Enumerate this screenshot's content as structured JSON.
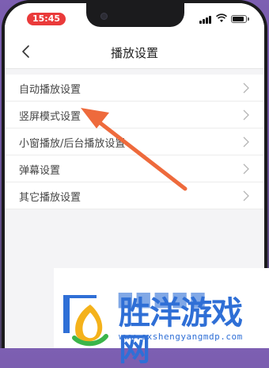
{
  "status_bar": {
    "time": "15:45",
    "icons": [
      "signal-icon",
      "wifi-icon",
      "battery-icon"
    ],
    "battery_level": 0.85
  },
  "navbar": {
    "back_icon": "chevron-left-icon",
    "title": "播放设置"
  },
  "settings": [
    {
      "label": "自动播放设置"
    },
    {
      "label": "竖屏模式设置"
    },
    {
      "label": "小窗播放/后台播放设置"
    },
    {
      "label": "弹幕设置"
    },
    {
      "label": "其它播放设置"
    }
  ],
  "annotation": {
    "type": "arrow",
    "color": "#ee6a3c"
  },
  "watermark": {
    "title": "胜洋游戏网",
    "url": "www.sxshengyangmdp.com"
  },
  "colors": {
    "time_pill": "#ea3a3a",
    "watermark_blue": "#2f6fd6"
  }
}
